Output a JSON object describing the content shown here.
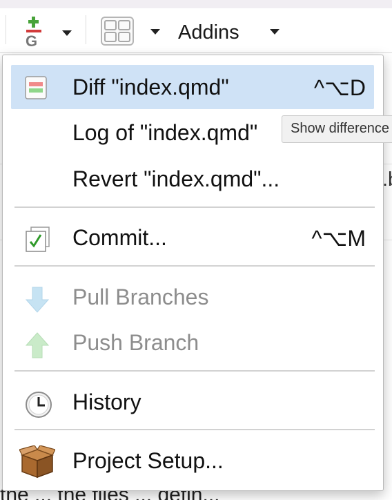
{
  "toolbar": {
    "git_icon": "git-add-icon",
    "grid_icon": "pane-layout-icon",
    "addins_label": "Addins"
  },
  "menu": {
    "items": [
      {
        "label": "Diff \"index.qmd\"",
        "shortcut": "^⌥D",
        "icon": "diff-icon",
        "selected": true
      },
      {
        "label": "Log of \"index.qmd\"",
        "icon": "none"
      },
      {
        "label": "Revert \"index.qmd\"...",
        "icon": "none"
      },
      {
        "label": "Commit...",
        "shortcut": "^⌥M",
        "icon": "commit-icon"
      },
      {
        "label": "Pull Branches",
        "icon": "pull-arrow-icon",
        "disabled": true
      },
      {
        "label": "Push Branch",
        "icon": "push-arrow-icon",
        "disabled": true
      },
      {
        "label": "History",
        "icon": "clock-icon"
      },
      {
        "label": "Project Setup...",
        "icon": "box-icon"
      }
    ]
  },
  "tooltip": {
    "text": "Show difference"
  },
  "background": {
    "peek_text": ".b",
    "bottom_text": "the ... the files ... defin..."
  }
}
